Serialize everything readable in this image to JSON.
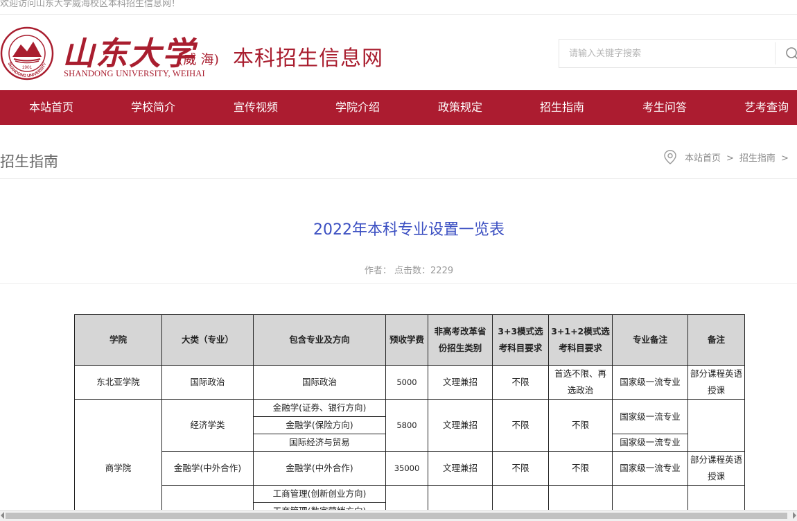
{
  "topbar": {
    "welcome": "欢迎访问山东大学威海校区本科招生信息网！"
  },
  "header": {
    "logo_cn": "山东大学",
    "logo_weihai": "(威 海)",
    "logo_en": "SHANDONG UNIVERSITY, WEIHAI",
    "seal_text": "SHANDONG UNIVERSITY",
    "seal_year": "1901",
    "site_title": "本科招生信息网",
    "search": {
      "placeholder": "请输入关键字搜索"
    }
  },
  "nav": {
    "items": [
      {
        "label": "本站首页"
      },
      {
        "label": "学校简介"
      },
      {
        "label": "宣传视频"
      },
      {
        "label": "学院介绍"
      },
      {
        "label": "政策规定"
      },
      {
        "label": "招生指南"
      },
      {
        "label": "考生问答"
      },
      {
        "label": "艺考查询"
      }
    ]
  },
  "section": {
    "title": "招生指南",
    "breadcrumb": {
      "home": "本站首页",
      "current": "招生指南",
      "sep": ">"
    }
  },
  "article": {
    "title": "2022年本科专业设置一览表",
    "meta": "作者：  点击数：2229"
  },
  "table": {
    "headers": {
      "college": "学院",
      "category": "大类（专业）",
      "majors": "包含专业及方向",
      "fee": "预收学费",
      "nonreform": "非高考改革省份招生类别",
      "mode33": "3+3模式选考科目要求",
      "mode312": "3+1+2模式选考科目要求",
      "major_note": "专业备注",
      "note": "备注"
    },
    "rows": {
      "r1": {
        "college": "东北亚学院",
        "category": "国际政治",
        "major": "国际政治",
        "fee": "5000",
        "nonreform": "文理兼招",
        "mode33": "不限",
        "mode312": "首选不限、再选政治",
        "major_note": "国家级一流专业",
        "note": "部分课程英语授课"
      },
      "r2": {
        "college": "商学院",
        "category": "经济学类",
        "major_a": "金融学(证券、银行方向)",
        "major_b": "金融学(保险方向)",
        "major_c": "国际经济与贸易",
        "fee": "5800",
        "nonreform": "文理兼招",
        "mode33": "不限",
        "mode312": "不限",
        "major_note_ab": "国家级一流专业",
        "major_note_c": "国家级一流专业",
        "note": ""
      },
      "r3": {
        "category": "金融学(中外合作)",
        "major": "金融学(中外合作)",
        "fee": "35000",
        "nonreform": "文理兼招",
        "mode33": "不限",
        "mode312": "不限",
        "major_note": "国家级一流专业",
        "note": "部分课程英语授课"
      },
      "r4": {
        "major_a": "工商管理(创新创业方向)",
        "major_b": "工商管理(数字营销方向)"
      }
    }
  },
  "colors": {
    "brand": "#ac1c30",
    "title_blue": "#3b4fc2"
  }
}
